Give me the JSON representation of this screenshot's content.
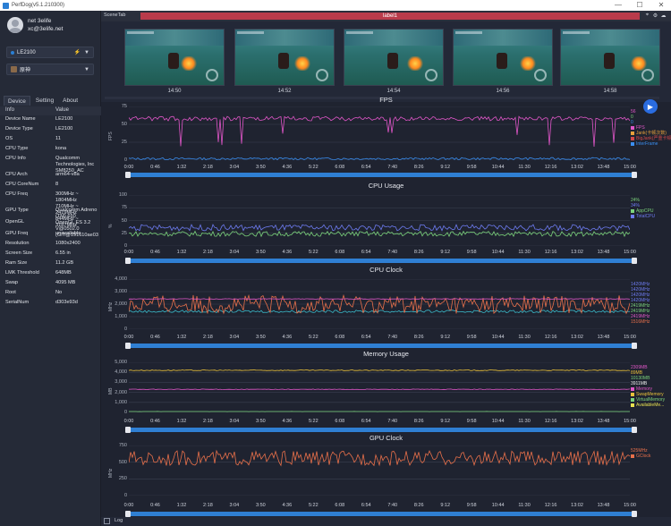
{
  "window": {
    "title": "PerfDog(v5.1.210300)",
    "controls": [
      "—",
      "☐",
      "✕"
    ]
  },
  "user": {
    "name": "net 3elife",
    "email": "xc@3elife.net"
  },
  "device_select": {
    "value": "LE2100"
  },
  "app_select": {
    "value": "原神"
  },
  "tabs": [
    {
      "label": "Device"
    },
    {
      "label": "Setting"
    },
    {
      "label": "About"
    }
  ],
  "table_header": {
    "info": "Info",
    "value": "Value"
  },
  "device_info": [
    {
      "k": "Device Name",
      "v": "LE2100"
    },
    {
      "k": "Device Type",
      "v": "LE2100"
    },
    {
      "k": "OS",
      "v": "11"
    },
    {
      "k": "CPU Type",
      "v": "kona"
    },
    {
      "k": "CPU Info",
      "v": "Qualcomm\nTechnologies, Inc\nSM8250_AC"
    },
    {
      "k": "CPU Arch",
      "v": "arm64-v8a"
    },
    {
      "k": "CPU CoreNum",
      "v": "8"
    },
    {
      "k": "CPU Freq",
      "v": "300MHz ~ 1804MHz\n710MHz ~ 2419MHz\n844MHz ~ 3187MHz"
    },
    {
      "k": "GPU Type",
      "v": "Qualcomm Adreno\n(TM) 650\nOpenGL ES 3.2\nV@0502.0\n(GIT@191610ae03"
    },
    {
      "k": "OpenGL",
      "v": ""
    },
    {
      "k": "GPU Freq",
      "v": "unavailable"
    },
    {
      "k": "Resolution",
      "v": "1080x2400"
    },
    {
      "k": "Screen Size",
      "v": "6.55 in"
    },
    {
      "k": "Ram Size",
      "v": "11.2 GB"
    },
    {
      "k": "LMK Threshold",
      "v": "648MB"
    },
    {
      "k": "Swap",
      "v": "4095 MB"
    },
    {
      "k": "Root",
      "v": "No"
    },
    {
      "k": "SerialNum",
      "v": "d303e93d"
    }
  ],
  "scene": {
    "tab_label": "SceneTab",
    "label": "label1"
  },
  "thumb_times": [
    "14:50",
    "14:52",
    "14:54",
    "14:56",
    "14:58"
  ],
  "x_ticks": [
    "0:00",
    "0:46",
    "1:32",
    "2:18",
    "3:04",
    "3:50",
    "4:36",
    "5:22",
    "6:08",
    "6:54",
    "7:40",
    "8:26",
    "9:12",
    "9:58",
    "10:44",
    "11:30",
    "12:16",
    "13:02",
    "13:48",
    "15:00"
  ],
  "charts": {
    "fps": {
      "title": "FPS",
      "ylabel": "FPS",
      "ticks": [
        "75",
        "50",
        "25",
        "0"
      ],
      "legend": [
        {
          "t": "56",
          "c": "#e056c8"
        },
        {
          "t": "0",
          "c": "#7bd37b"
        },
        {
          "t": "0",
          "c": "#3a8ef0"
        },
        {
          "t": "FPS",
          "c": "#e056c8"
        },
        {
          "t": "Jank(卡顿次数)",
          "c": "#e8a03a"
        },
        {
          "t": "BigJank(严重卡顿次数)",
          "c": "#d04848"
        },
        {
          "t": "InterFrame",
          "c": "#3a8ef0"
        }
      ]
    },
    "cpu_usage": {
      "title": "CPU Usage",
      "ylabel": "%",
      "ticks": [
        "100",
        "75",
        "50",
        "25",
        "0"
      ],
      "legend": [
        {
          "t": "24%",
          "c": "#7bd37b"
        },
        {
          "t": "34%",
          "c": "#6d7bf0"
        },
        {
          "t": "AppCPU",
          "c": "#7bd37b"
        },
        {
          "t": "TotalCPU",
          "c": "#6d7bf0"
        }
      ]
    },
    "cpu_clock": {
      "title": "CPU Clock",
      "ylabel": "MHz",
      "ticks": [
        "4,000",
        "3,000",
        "2,000",
        "1,000",
        "0"
      ],
      "legend": [
        {
          "t": "1420MHz",
          "c": "#6d7bf0"
        },
        {
          "t": "1420MHz",
          "c": "#6d7bf0"
        },
        {
          "t": "1420MHz",
          "c": "#6d7bf0"
        },
        {
          "t": "1420MHz",
          "c": "#6d7bf0"
        },
        {
          "t": "2419MHz",
          "c": "#7bd37b"
        },
        {
          "t": "2419MHz",
          "c": "#7bd37b"
        },
        {
          "t": "2419MHz",
          "c": "#e056c8"
        },
        {
          "t": "1516MHz",
          "c": "#e8704a"
        }
      ]
    },
    "memory": {
      "title": "Memory Usage",
      "ylabel": "MB",
      "ticks": [
        "5,000",
        "4,000",
        "3,000",
        "2,000",
        "1,000",
        "0"
      ],
      "legend": [
        {
          "t": "2309MB",
          "c": "#e056c8"
        },
        {
          "t": "89MB",
          "c": "#e8c03a"
        },
        {
          "t": "10130MB",
          "c": "#7bd37b"
        },
        {
          "t": "3911MB",
          "c": "#f0f0f0"
        },
        {
          "t": "Memory",
          "c": "#e056c8"
        },
        {
          "t": "SwapMemory",
          "c": "#e8c03a"
        },
        {
          "t": "VirtualMemory",
          "c": "#7bd37b"
        },
        {
          "t": "AvailableMe...",
          "c": "#e8e050"
        }
      ]
    },
    "gpu_clock": {
      "title": "GPU Clock",
      "ylabel": "MHz",
      "ticks": [
        "750",
        "500",
        "250",
        "0"
      ],
      "legend": [
        {
          "t": "525MHz",
          "c": "#e8704a"
        },
        {
          "t": "GClock",
          "c": "#e8704a"
        }
      ]
    }
  },
  "bottom": {
    "log": "Log"
  },
  "colors": {
    "accent": "#2f7fd3",
    "label_bar": "#b93b4b",
    "fps": "#e056c8",
    "cpu_app": "#7bd37b",
    "cpu_total": "#6d7bf0",
    "cpu_clock": "#e8704a",
    "gpu_clock": "#e8704a"
  }
}
